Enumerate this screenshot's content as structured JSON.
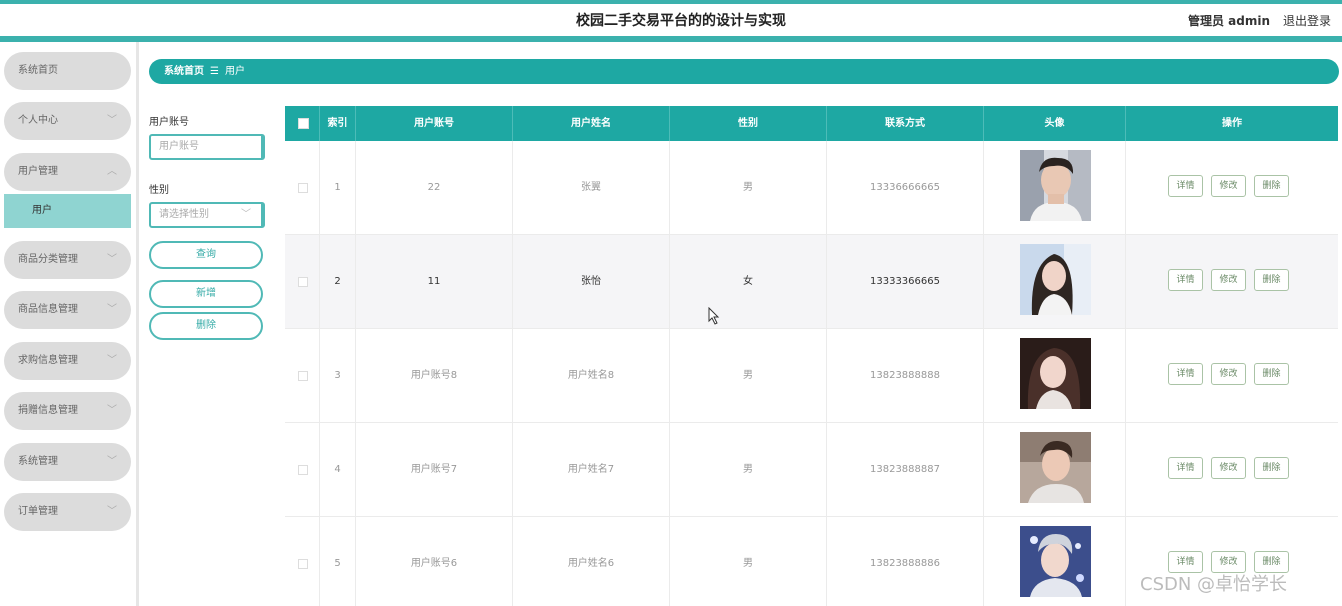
{
  "header": {
    "title": "校园二手交易平台的的设计与实现",
    "user_label": "管理员 admin",
    "logout": "退出登录"
  },
  "sidebar": {
    "items": [
      {
        "label": "系统首页",
        "has_chevron": false
      },
      {
        "label": "个人中心",
        "has_chevron": true
      },
      {
        "label": "用户管理",
        "has_chevron": true,
        "expanded": true
      },
      {
        "label": "商品分类管理",
        "has_chevron": true
      },
      {
        "label": "商品信息管理",
        "has_chevron": true
      },
      {
        "label": "求购信息管理",
        "has_chevron": true
      },
      {
        "label": "捐赠信息管理",
        "has_chevron": true
      },
      {
        "label": "系统管理",
        "has_chevron": true
      },
      {
        "label": "订单管理",
        "has_chevron": true
      }
    ],
    "submenu": {
      "label": "用户"
    }
  },
  "breadcrumb": {
    "home": "系统首页",
    "separator": "☰",
    "current": "用户"
  },
  "filters": {
    "account_label": "用户账号",
    "account_placeholder": "用户账号",
    "gender_label": "性别",
    "gender_placeholder": "请选择性别",
    "search_button": "查询",
    "add_button": "新增",
    "delete_button": "删除"
  },
  "table": {
    "headers": [
      "索引",
      "用户账号",
      "用户姓名",
      "性别",
      "联系方式",
      "头像",
      "操作"
    ],
    "rows": [
      {
        "index": "1",
        "account": "22",
        "name": "张翼",
        "gender": "男",
        "phone": "13336666665"
      },
      {
        "index": "2",
        "account": "11",
        "name": "张怡",
        "gender": "女",
        "phone": "13333366665"
      },
      {
        "index": "3",
        "account": "用户账号8",
        "name": "用户姓名8",
        "gender": "男",
        "phone": "13823888888"
      },
      {
        "index": "4",
        "account": "用户账号7",
        "name": "用户姓名7",
        "gender": "男",
        "phone": "13823888887"
      },
      {
        "index": "5",
        "account": "用户账号6",
        "name": "用户姓名6",
        "gender": "男",
        "phone": "13823888886"
      }
    ],
    "actions": {
      "detail": "详情",
      "edit": "修改",
      "delete": "删除"
    }
  },
  "watermark": "CSDN @卓怡学长",
  "colors": {
    "accent": "#1ea8a3",
    "sidebar_item": "#dcdcdc",
    "submenu_active": "#8fd4d1"
  }
}
